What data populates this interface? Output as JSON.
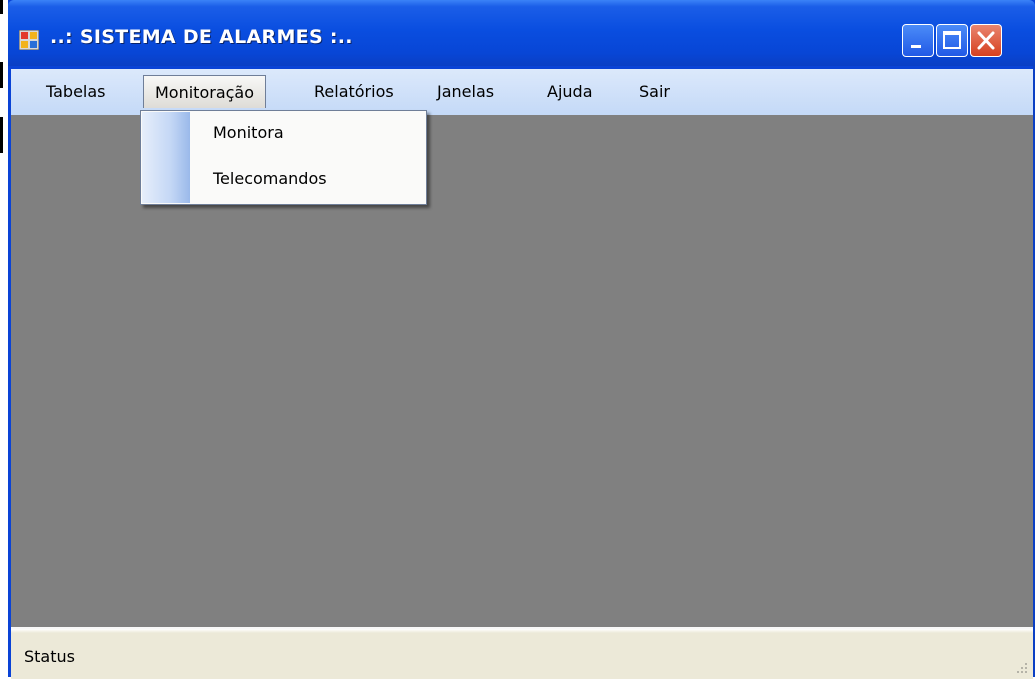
{
  "window": {
    "title": "..: SISTEMA DE ALARMES :..",
    "title_color": "#ffffff",
    "titlebar_color": "#0a4ee0",
    "controls": {
      "minimize": "minimize-icon",
      "maximize": "maximize-icon",
      "close": "close-icon"
    }
  },
  "menu": {
    "items": [
      {
        "label": "Tabelas"
      },
      {
        "label": "Monitoração"
      },
      {
        "label": "Relatórios"
      },
      {
        "label": "Janelas"
      },
      {
        "label": "Ajuda"
      },
      {
        "label": "Sair"
      }
    ],
    "open_menu": "Monitoração",
    "dropdown": [
      {
        "label": "Monitora"
      },
      {
        "label": "Telecomandos"
      }
    ]
  },
  "client_area": {
    "background": "#808080"
  },
  "statusbar": {
    "text": "Status"
  }
}
